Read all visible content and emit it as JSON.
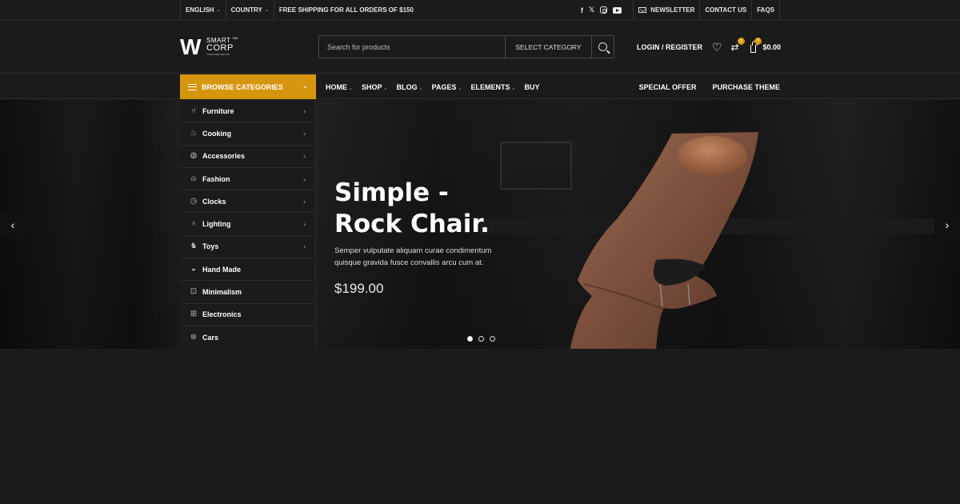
{
  "topbar": {
    "language": "ENGLISH",
    "country": "COUNTRY",
    "shipping": "FREE SHIPPING FOR ALL ORDERS OF $150",
    "newsletter": "NEWSLETTER",
    "contact": "CONTACT US",
    "faqs": "FAQS",
    "social": [
      "facebook-icon",
      "x-icon",
      "instagram-icon",
      "youtube-icon"
    ]
  },
  "logo": {
    "mark": "W",
    "line1": "SMART",
    "line2": "CORP",
    "tagline": "TOGETHER WE WIN",
    "reg": "INC"
  },
  "search": {
    "placeholder": "Search for products",
    "category": "SELECT CATEGORY"
  },
  "account": {
    "login": "LOGIN / REGISTER",
    "compare_count": "0",
    "cart_count": "0",
    "cart_total": "$0.00"
  },
  "nav": {
    "browse": "BROWSE CATEGORIES",
    "items": [
      {
        "label": "HOME",
        "dropdown": true
      },
      {
        "label": "SHOP",
        "dropdown": true
      },
      {
        "label": "BLOG",
        "dropdown": true
      },
      {
        "label": "PAGES",
        "dropdown": true
      },
      {
        "label": "ELEMENTS",
        "dropdown": true
      },
      {
        "label": "BUY",
        "dropdown": false
      }
    ],
    "right": [
      "SPECIAL OFFER",
      "PURCHASE THEME"
    ]
  },
  "categories": [
    {
      "label": "Furniture",
      "icon": "chair-icon",
      "sub": true
    },
    {
      "label": "Cooking",
      "icon": "pot-icon",
      "sub": true
    },
    {
      "label": "Accessories",
      "icon": "accessories-icon",
      "sub": true
    },
    {
      "label": "Fashion",
      "icon": "shirt-icon",
      "sub": true
    },
    {
      "label": "Clocks",
      "icon": "clock-icon",
      "sub": true
    },
    {
      "label": "Lighting",
      "icon": "bulb-icon",
      "sub": true
    },
    {
      "label": "Toys",
      "icon": "toy-icon",
      "sub": true
    },
    {
      "label": "Hand Made",
      "icon": "handmade-icon",
      "sub": false
    },
    {
      "label": "Minimalism",
      "icon": "minimal-icon",
      "sub": false
    },
    {
      "label": "Electronics",
      "icon": "electronics-icon",
      "sub": false
    },
    {
      "label": "Cars",
      "icon": "car-icon",
      "sub": false
    }
  ],
  "hero": {
    "title_line1": "Simple -",
    "title_line2": "Rock Chair.",
    "description": "Semper vulputate aliquam curae condimentum quisque gravida fusce convallis arcu cum at.",
    "price": "$199.00",
    "slide_count": 3,
    "active_slide": 1
  },
  "colors": {
    "accent": "#d6950e",
    "background": "#1b1b1b"
  }
}
